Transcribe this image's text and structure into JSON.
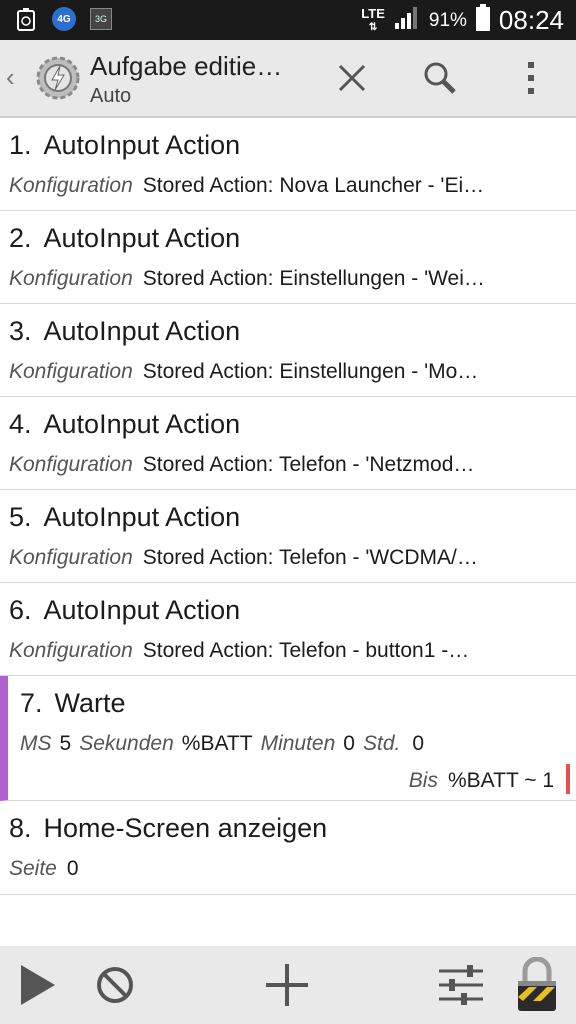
{
  "status": {
    "lte": "LTE",
    "battery": "91%",
    "time": "08:24",
    "icons": [
      "recycle-icon",
      "4g-icon",
      "3g-icon"
    ]
  },
  "actionbar": {
    "title": "Aufgabe editie…",
    "subtitle": "Auto"
  },
  "actions": [
    {
      "num": "1.",
      "title": "AutoInput Action",
      "label": "Konfiguration",
      "value": "Stored Action: Nova Launcher - 'Ei…"
    },
    {
      "num": "2.",
      "title": "AutoInput Action",
      "label": "Konfiguration",
      "value": "Stored Action: Einstellungen - 'Wei…"
    },
    {
      "num": "3.",
      "title": "AutoInput Action",
      "label": "Konfiguration",
      "value": "Stored Action: Einstellungen - 'Mo…"
    },
    {
      "num": "4.",
      "title": "AutoInput Action",
      "label": "Konfiguration",
      "value": "Stored Action: Telefon - 'Netzmod…"
    },
    {
      "num": "5.",
      "title": "AutoInput Action",
      "label": "Konfiguration",
      "value": "Stored Action: Telefon - 'WCDMA/…"
    },
    {
      "num": "6.",
      "title": "AutoInput Action",
      "label": "Konfiguration",
      "value": "Stored Action: Telefon - button1 -…"
    }
  ],
  "warte": {
    "num": "7.",
    "title": "Warte",
    "ms_label": "MS",
    "ms_value": "5",
    "sek_label": "Sekunden",
    "sek_value": "%BATT",
    "min_label": "Minuten",
    "min_value": "0",
    "std_label": "Std.",
    "std_value": "0",
    "bis_label": "Bis",
    "bis_value": "%BATT ~ 1",
    "accent": "#b060d0"
  },
  "home": {
    "num": "8.",
    "title": "Home-Screen anzeigen",
    "label": "Seite",
    "value": "0"
  },
  "bottombar": {
    "icons": [
      "play-icon",
      "disable-icon",
      "add-icon",
      "settings-sliders-icon",
      "lock-icon"
    ]
  }
}
